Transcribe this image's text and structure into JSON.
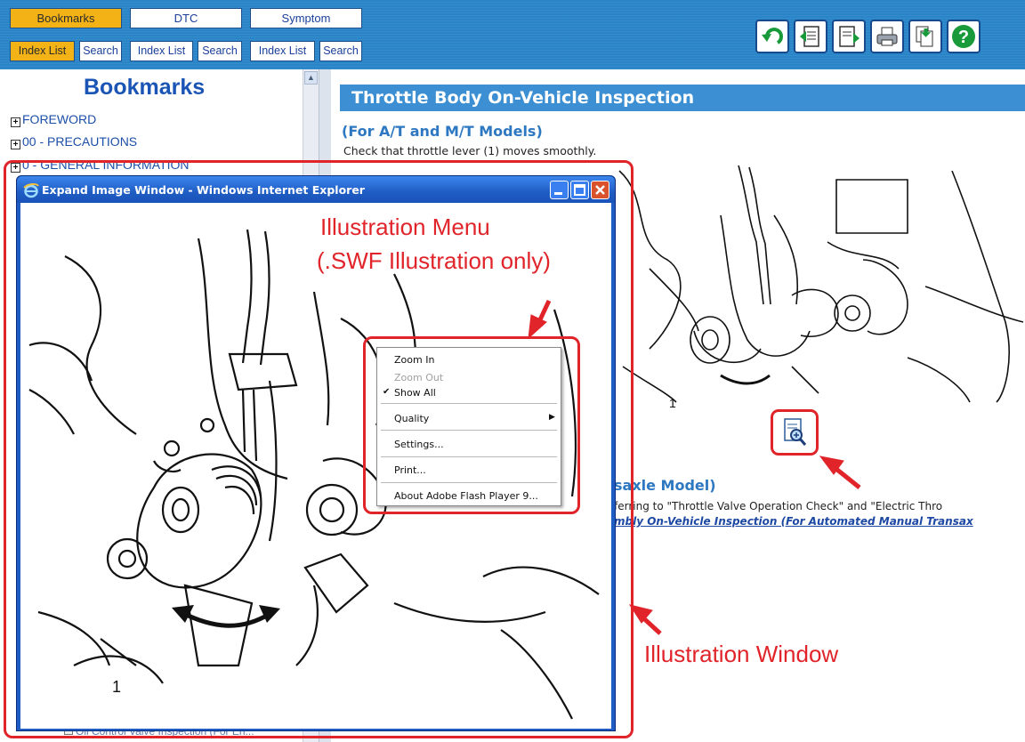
{
  "toolbar": {
    "tabs": [
      "Bookmarks",
      "DTC",
      "Symptom"
    ],
    "sub_buttons": [
      "Index List",
      "Search",
      "Index List",
      "Search",
      "Index List",
      "Search"
    ],
    "icons": [
      "back-icon",
      "document-prev-icon",
      "document-next-icon",
      "print-icon",
      "copy-icon",
      "help-icon"
    ],
    "colors": {
      "bar": "#2a84c8",
      "active": "#f3b316"
    }
  },
  "left_pane": {
    "title": "Bookmarks",
    "items": [
      "FOREWORD",
      "00 - PRECAUTIONS",
      "0 - GENERAL INFORMATION"
    ],
    "bottom_item": "Oil Control Valve Inspection (For En..."
  },
  "content": {
    "section_title": "Throttle Body On-Vehicle Inspection",
    "sub_heading": "(For A/T and M/T Models)",
    "check_text": "Check that throttle lever (1) moves smoothly.",
    "sub_heading2": "saxle Model)",
    "ref_text": "ferring to \"Throttle Valve Operation Check\" and \"Electric Thro",
    "ref_link": "mbly On-Vehicle Inspection (For Automated Manual Transax",
    "illustration_label": "1"
  },
  "popup": {
    "title": "Expand Image Window - Windows Internet Explorer",
    "illustration_label": "1"
  },
  "context_menu": {
    "items": [
      {
        "label": "Zoom In",
        "disabled": false
      },
      {
        "label": "Zoom Out",
        "disabled": true
      },
      {
        "label": "Show All",
        "disabled": false,
        "checked": true
      },
      {
        "label": "Quality",
        "disabled": false,
        "submenu": true
      },
      {
        "label": "Settings...",
        "disabled": false
      },
      {
        "label": "Print...",
        "disabled": false
      },
      {
        "label": "About Adobe Flash Player 9...",
        "disabled": false
      }
    ]
  },
  "annotations": {
    "menu_label_line1": "Illustration Menu",
    "menu_label_line2": "(.SWF Illustration only)",
    "window_label": "Illustration Window",
    "color": "#e0242a"
  }
}
